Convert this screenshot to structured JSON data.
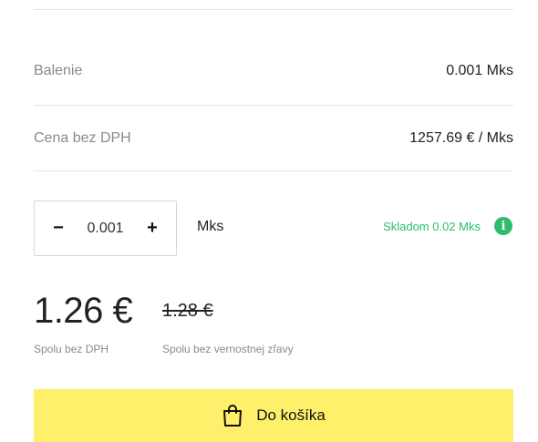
{
  "details": {
    "packaging_label": "Balenie",
    "packaging_value": "0.001 Mks",
    "price_label": "Cena bez DPH",
    "price_value": "1257.69 € / Mks"
  },
  "quantity": {
    "minus_label": "−",
    "value": "0.001",
    "plus_label": "+",
    "unit": "Mks"
  },
  "stock": {
    "text": "Skladom 0.02 Mks",
    "icon": "info-icon",
    "info_glyph": "i",
    "color": "#2ebd6b"
  },
  "pricing": {
    "total": "1.26 €",
    "total_caption": "Spolu bez DPH",
    "old_total": "1.28 €",
    "old_total_caption": "Spolu bez vernostnej zľavy"
  },
  "cart": {
    "label": "Do košíka",
    "icon": "shopping-bag-icon",
    "background": "#fff06b"
  }
}
